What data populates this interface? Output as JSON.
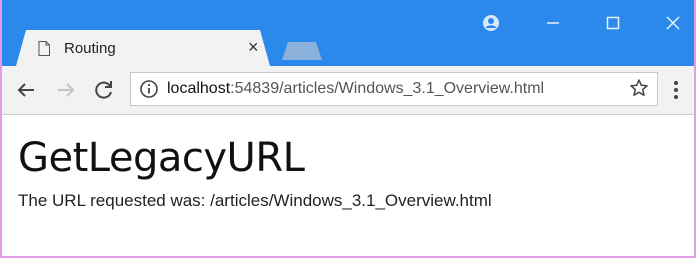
{
  "browser": {
    "tab_title": "Routing",
    "tab_close": "×",
    "address": {
      "host": "localhost",
      "path": ":54839/articles/Windows_3.1_Overview.html"
    }
  },
  "page": {
    "heading": "GetLegacyURL",
    "message": "The URL requested was: /articles/Windows_3.1_Overview.html"
  },
  "colors": {
    "titlebar": "#2b89ec",
    "toolbar": "#f2f2f2"
  }
}
